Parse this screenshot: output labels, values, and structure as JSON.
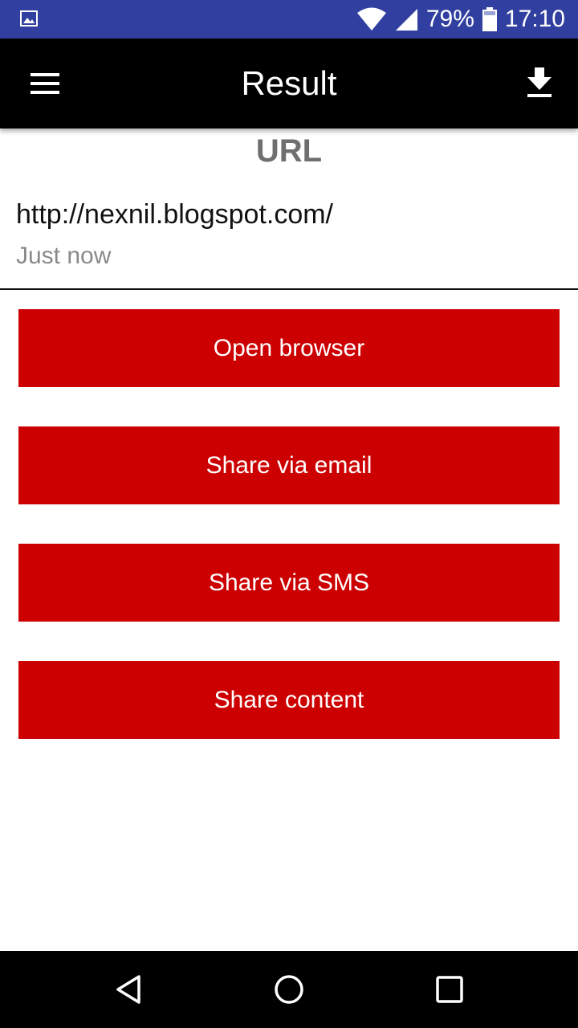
{
  "status_bar": {
    "battery_percent": "79%",
    "time": "17:10",
    "icons": [
      "gallery-icon",
      "wifi-icon",
      "signal-icon",
      "battery-icon"
    ],
    "background_color": "#3140a0"
  },
  "app_bar": {
    "title": "Result",
    "icons": [
      "menu-icon",
      "download-icon"
    ],
    "background_color": "#000000"
  },
  "result": {
    "heading": "URL",
    "url": "http://nexnil.blogspot.com/",
    "time": "Just now"
  },
  "actions": [
    {
      "label": "Open browser"
    },
    {
      "label": "Share via email"
    },
    {
      "label": "Share via SMS"
    },
    {
      "label": "Share content"
    }
  ],
  "accent_color": "#cc0000",
  "nav_bar": {
    "icons": [
      "back-icon",
      "home-icon",
      "recents-icon"
    ]
  }
}
